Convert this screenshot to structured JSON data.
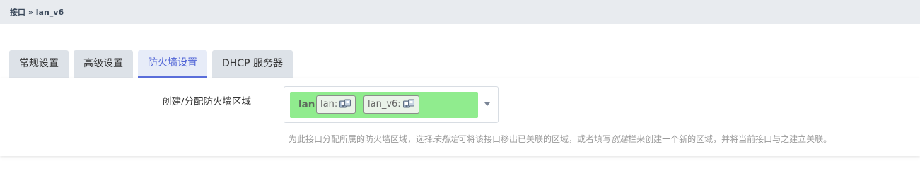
{
  "breadcrumb": "接口 » lan_v6",
  "tabs": [
    {
      "label": "常规设置",
      "active": false
    },
    {
      "label": "高级设置",
      "active": false
    },
    {
      "label": "防火墙设置",
      "active": true
    },
    {
      "label": "DHCP 服务器",
      "active": false
    }
  ],
  "firewall": {
    "field_label": "创建/分配防火墙区域",
    "zone": {
      "name": "lan",
      "color": "#90ec8e",
      "interfaces": [
        {
          "label": "lan:",
          "icon": "ethernet-port-icon"
        },
        {
          "label": "lan_v6:",
          "icon": "ethernet-port-icon"
        }
      ]
    },
    "dropdown_icon": "caret-down-icon",
    "help": {
      "part1": "为此接口分配所属的防火墙区域，选择",
      "em1": "未指定",
      "part2": "可将该接口移出已关联的区域，或者填写",
      "em2": "创建",
      "part3": "栏来创建一个新的区域，并将当前接口与之建立关联。"
    }
  },
  "colors": {
    "accent": "#5b6fdc",
    "topbar": "#e8ebef",
    "tab_inactive": "#dde2e8",
    "zone_green": "#90ec8e"
  }
}
